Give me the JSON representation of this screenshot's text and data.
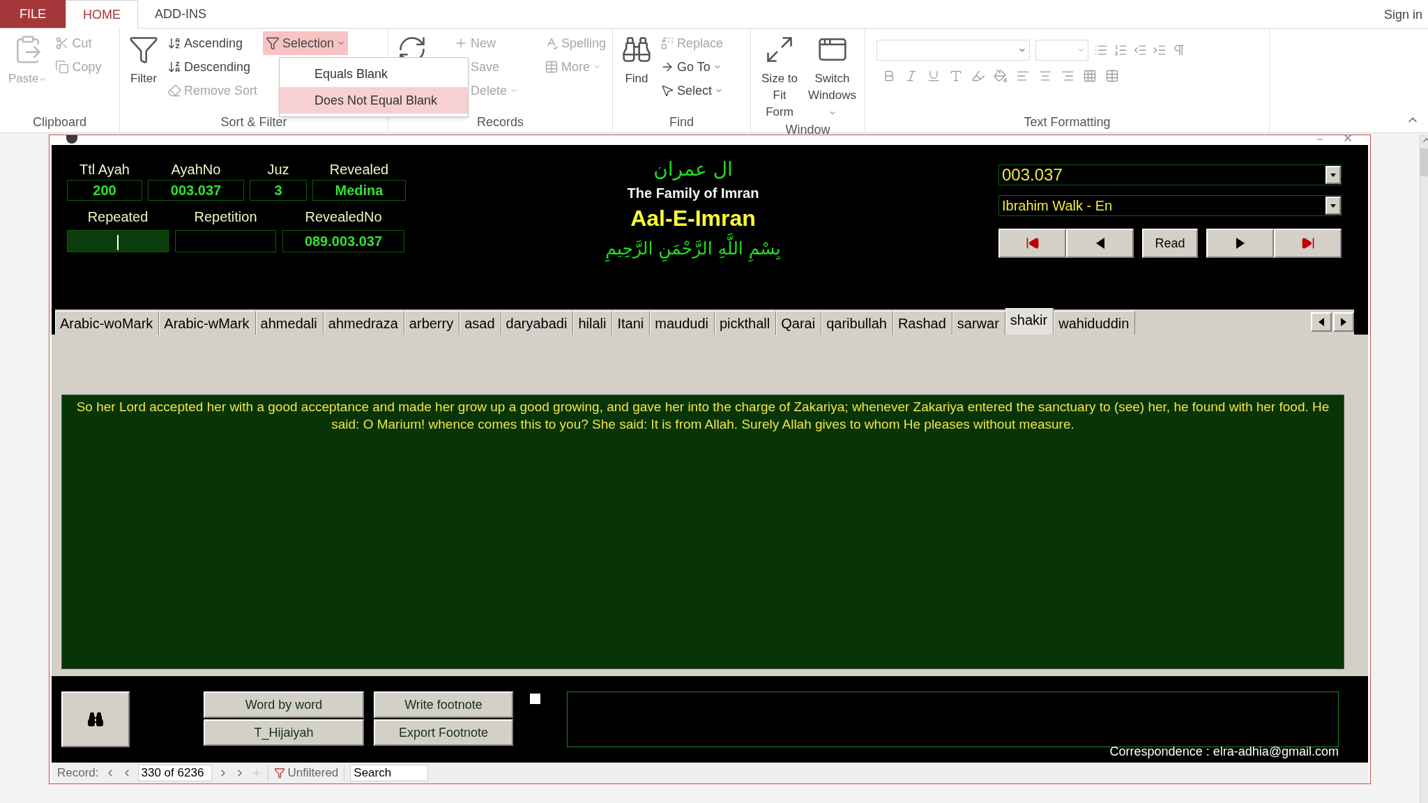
{
  "ribbon_tabs": [
    {
      "label": "FILE",
      "kind": "file",
      "selected": false
    },
    {
      "label": "HOME",
      "kind": "tab",
      "selected": true
    },
    {
      "label": "ADD-INS",
      "kind": "tab",
      "selected": false
    }
  ],
  "sign_in": "Sign in",
  "ribbon_groups": [
    {
      "label": "Clipboard",
      "columns": [
        [
          {
            "label": "Paste",
            "kind": "large",
            "disabled": true,
            "dropdown": true
          }
        ],
        [
          {
            "label": "Cut",
            "kind": "small",
            "disabled": true
          },
          {
            "label": "Copy",
            "kind": "small",
            "disabled": true
          }
        ]
      ]
    },
    {
      "label": "Sort & Filter",
      "columns": [
        [
          {
            "label": "Filter",
            "kind": "large",
            "disabled": false
          }
        ],
        [
          {
            "label": "Ascending",
            "kind": "small",
            "disabled": false
          },
          {
            "label": "Descending",
            "kind": "small",
            "disabled": false
          },
          {
            "label": "Remove Sort",
            "kind": "small",
            "disabled": true
          }
        ],
        [
          {
            "label": "Selection",
            "kind": "small",
            "disabled": false,
            "dropdown": true,
            "open": true
          }
        ]
      ]
    },
    {
      "label": "Records",
      "columns": [
        [
          {
            "kind": "large",
            "disabled": false
          }
        ],
        [
          {
            "label": "New",
            "kind": "small",
            "disabled": true
          },
          {
            "label": "Save",
            "kind": "small",
            "disabled": true
          },
          {
            "label": "Delete",
            "kind": "small",
            "disabled": true,
            "dropdown": true
          }
        ],
        [
          {
            "label": "Spelling",
            "kind": "small",
            "disabled": true
          },
          {
            "label": "More",
            "kind": "small",
            "disabled": true,
            "dropdown": true
          }
        ]
      ]
    },
    {
      "label": "Find",
      "columns": [
        [
          {
            "label": "Find",
            "kind": "large",
            "disabled": false
          }
        ],
        [
          {
            "label": "Replace",
            "kind": "small",
            "disabled": true
          },
          {
            "label": "Go To",
            "kind": "small",
            "disabled": false,
            "dropdown": true
          },
          {
            "label": "Select",
            "kind": "small",
            "disabled": false,
            "dropdown": true
          }
        ]
      ]
    },
    {
      "label": "Window",
      "columns": [
        [
          {
            "label": "Size to Fit Form",
            "kind": "large",
            "disabled": false
          }
        ],
        [
          {
            "label": "Switch Windows",
            "kind": "large",
            "disabled": false,
            "dropdown": true
          }
        ]
      ]
    },
    {
      "label": "Text Formatting",
      "kind": "formatting"
    }
  ],
  "selection_menu": [
    {
      "label": "Equals Blank",
      "selected": false
    },
    {
      "label": "Does Not Equal Blank",
      "selected": true
    }
  ],
  "form": {
    "info_fields": [
      {
        "label": "Ttl Ayah",
        "value": "200"
      },
      {
        "label": "AyahNo",
        "value": "003.037"
      },
      {
        "label": "Juz",
        "value": "3"
      },
      {
        "label": "Revealed",
        "value": "Medina"
      }
    ],
    "info_fields_2": [
      {
        "label": "Repeated",
        "focused": true
      },
      {
        "label": "Repetition",
        "focused": false
      },
      {
        "label": "RevealedNo",
        "value": "089.003.037",
        "focused": false
      }
    ],
    "surah": {
      "arabic": "ال عمران",
      "english": "The Family of Imran",
      "title": "Aal-E-Imran",
      "basmala": "بِسْمِ اللَّهِ الرَّحْمَنِ الرَّحِيمِ"
    },
    "ayah_combo": "003.037",
    "reciter_combo": "Ibrahim Walk - En",
    "nav_buttons": [
      {
        "kind": "first"
      },
      {
        "kind": "prev"
      },
      {
        "kind": "read",
        "label": "Read"
      },
      {
        "kind": "next"
      },
      {
        "kind": "last"
      }
    ],
    "translation_tabs": [
      {
        "label": "Arabic-woMark",
        "selected": false
      },
      {
        "label": "Arabic-wMark",
        "selected": false
      },
      {
        "label": "ahmedali",
        "selected": false
      },
      {
        "label": "ahmedraza",
        "selected": false
      },
      {
        "label": "arberry",
        "selected": false
      },
      {
        "label": "asad",
        "selected": false
      },
      {
        "label": "daryabadi",
        "selected": false
      },
      {
        "label": "hilali",
        "selected": false
      },
      {
        "label": "Itani",
        "selected": false
      },
      {
        "label": "maududi",
        "selected": false
      },
      {
        "label": "pickthall",
        "selected": false
      },
      {
        "label": "Qarai",
        "selected": false
      },
      {
        "label": "qaribullah",
        "selected": false
      },
      {
        "label": "Rashad",
        "selected": false
      },
      {
        "label": "sarwar",
        "selected": false
      },
      {
        "label": "shakir",
        "selected": true
      },
      {
        "label": "wahiduddin",
        "selected": false
      }
    ],
    "translation_text": "So her Lord accepted her with a good acceptance and made her grow up a good growing, and gave her into the charge of Zakariya; whenever Zakariya entered the sanctuary to (see) her, he found with her food. He said: O Marium! whence comes this to you? She said: It is from Allah. Surely Allah gives to whom He pleases without measure.",
    "action_buttons": [
      [
        "Word by word",
        "T_Hijaiyah"
      ],
      [
        "Write footnote",
        "Export Footnote"
      ]
    ],
    "footnote_checkbox": {
      "checked": false
    },
    "correspondence": "Correspondence : elra-adhia@gmail.com"
  },
  "record_nav": {
    "label": "Record:",
    "position": "330 of 6236",
    "filter": "Unfiltered",
    "search_placeholder": "Search"
  }
}
